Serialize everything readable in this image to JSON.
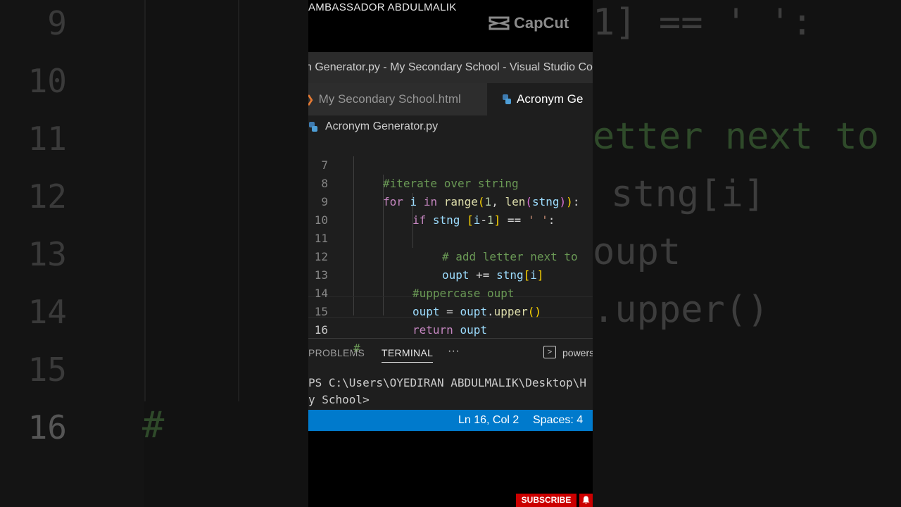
{
  "background": {
    "line_numbers": [
      "9",
      "10",
      "11",
      "12",
      "13",
      "14",
      "15",
      "16"
    ],
    "code_fragments": [
      "1] == ' ':",
      "etter next to",
      "stng[i]",
      "oupt",
      ".upper()",
      "#"
    ]
  },
  "watermark": {
    "channel_name": "AMBASSADOR ABDULMALIK",
    "app_logo": "CapCut"
  },
  "vscode": {
    "title": "n Generator.py - My Secondary School - Visual Studio Co",
    "tabs": [
      {
        "label": "My Secondary School.html",
        "icon": "html-chevron-icon"
      },
      {
        "label": "Acronym Ge",
        "icon": "python-icon",
        "active": true
      }
    ],
    "breadcrumb": "Acronym Generator.py",
    "editor": {
      "current_line": "16",
      "lines": [
        {
          "num": "7",
          "text": "#iterate over string"
        },
        {
          "num": "8",
          "text": "for i in range(1, len(stng)):"
        },
        {
          "num": "9",
          "text": "if stng [i-1] == ' ':"
        },
        {
          "num": "10",
          "text": ""
        },
        {
          "num": "11",
          "text": "# add letter next to"
        },
        {
          "num": "12",
          "text": "oupt += stng[i]"
        },
        {
          "num": "13",
          "text": "#uppercase oupt"
        },
        {
          "num": "14",
          "text": "oupt = oupt.upper()"
        },
        {
          "num": "15",
          "text": "return oupt"
        },
        {
          "num": "16",
          "text": "#"
        }
      ]
    },
    "panel": {
      "tabs": [
        "PROBLEMS",
        "TERMINAL",
        "···"
      ],
      "active_tab": "TERMINAL",
      "shell": "powers",
      "terminal_lines": [
        "PS C:\\Users\\OYEDIRAN ABDULMALIK\\Desktop\\H",
        "y School>"
      ]
    },
    "statusbar": {
      "position": "Ln 16, Col 2",
      "spaces": "Spaces: 4"
    }
  },
  "overlay": {
    "subscribe_label": "SUBSCRIBE",
    "bell_icon": "bell-icon"
  },
  "colors": {
    "statusbar": "#007acc",
    "subscribe": "#cc0000",
    "keyword": "#c586c0",
    "comment": "#6a9955",
    "function": "#dcdcaa"
  }
}
